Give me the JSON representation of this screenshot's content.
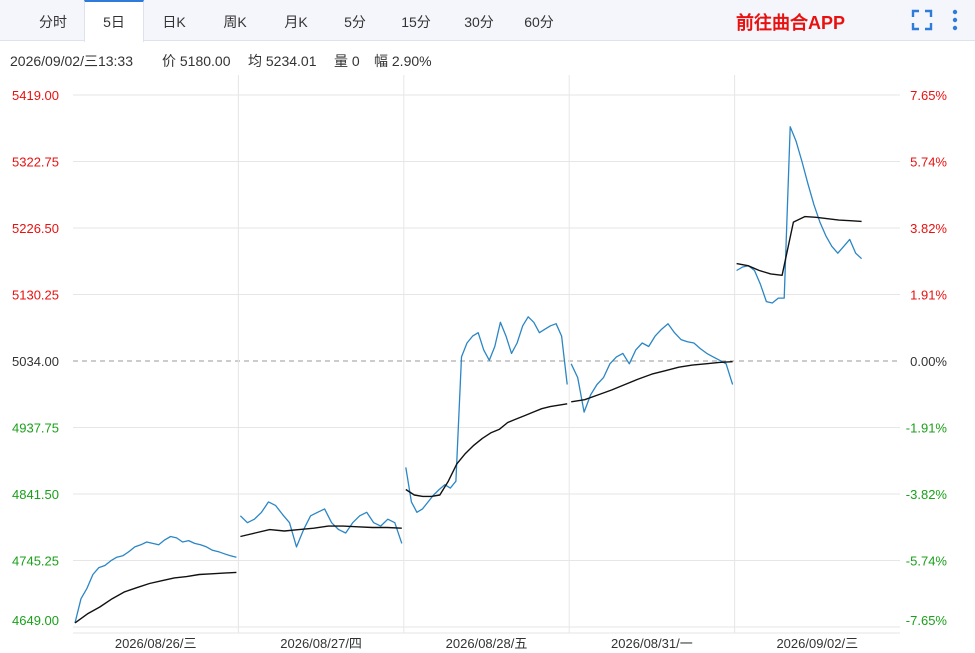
{
  "tabs": [
    {
      "label": "分时",
      "active": false
    },
    {
      "label": "5日",
      "active": true
    },
    {
      "label": "日K",
      "active": false
    },
    {
      "label": "周K",
      "active": false
    },
    {
      "label": "月K",
      "active": false
    },
    {
      "label": "5分",
      "active": false
    },
    {
      "label": "15分",
      "active": false
    },
    {
      "label": "30分",
      "active": false
    },
    {
      "label": "60分",
      "active": false
    }
  ],
  "app_link": "前往曲合APP",
  "icons": {
    "fullscreen": "fullscreen-icon",
    "more": "more-vertical-icon"
  },
  "info": {
    "datetime": "2026/09/02/三13:33",
    "price": "价 5180.00",
    "avg": "均 5234.01",
    "volume": "量 0",
    "amplitude": "幅 2.90%"
  },
  "colors": {
    "up": "#e8110f",
    "down": "#1aa01a",
    "neutral": "#333333",
    "price_line": "#2b86c6",
    "avg_line": "#111111",
    "grid": "#e6e6e6",
    "accent_tab": "#2f7bd9"
  },
  "chart_data": {
    "type": "line",
    "base": 5034.0,
    "ylim": [
      4649.0,
      5419.0
    ],
    "y_ticks": [
      "5419.00",
      "5322.75",
      "5226.50",
      "5130.25",
      "5034.00",
      "4937.75",
      "4841.50",
      "4745.25",
      "4649.00"
    ],
    "pct_ticks": [
      "7.65%",
      "5.74%",
      "3.82%",
      "1.91%",
      "0.00%",
      "-1.91%",
      "-3.82%",
      "-5.74%",
      "-7.65%"
    ],
    "days": [
      "2026/08/26/三",
      "2026/08/27/四",
      "2026/08/28/五",
      "2026/08/31/一",
      "2026/09/02/三"
    ],
    "grid": true,
    "series": [
      {
        "role": "price",
        "days": [
          [
            4655,
            4690,
            4705,
            4725,
            4735,
            4738,
            4745,
            4750,
            4752,
            4758,
            4765,
            4768,
            4772,
            4770,
            4768,
            4775,
            4780,
            4778,
            4772,
            4774,
            4770,
            4768,
            4765,
            4760,
            4758,
            4755,
            4752,
            4750
          ],
          [
            4810,
            4800,
            4805,
            4815,
            4830,
            4825,
            4812,
            4800,
            4765,
            4790,
            4810,
            4815,
            4820,
            4800,
            4790,
            4785,
            4800,
            4810,
            4815,
            4800,
            4795,
            4805,
            4800,
            4770
          ],
          [
            4880,
            4830,
            4815,
            4820,
            4830,
            4840,
            4848,
            4855,
            4850,
            4860,
            5040,
            5060,
            5070,
            5075,
            5050,
            5035,
            5055,
            5090,
            5070,
            5045,
            5060,
            5085,
            5098,
            5090,
            5075,
            5080,
            5085,
            5088,
            5070,
            5000
          ],
          [
            5030,
            5010,
            4960,
            4985,
            5000,
            5010,
            5030,
            5040,
            5045,
            5030,
            5050,
            5060,
            5055,
            5070,
            5080,
            5088,
            5075,
            5065,
            5062,
            5060,
            5052,
            5045,
            5040,
            5035,
            5030,
            5000
          ],
          [
            5165,
            5170,
            5172,
            5165,
            5145,
            5120,
            5118,
            5125,
            5125,
            5373,
            5352,
            5322,
            5290,
            5260,
            5235,
            5215,
            5200,
            5190,
            5200,
            5210,
            5190,
            5182
          ]
        ]
      },
      {
        "role": "avg",
        "days": [
          [
            4655,
            4668,
            4678,
            4690,
            4700,
            4706,
            4712,
            4716,
            4720,
            4722,
            4725,
            4726,
            4727,
            4728
          ],
          [
            4780,
            4785,
            4790,
            4788,
            4790,
            4792,
            4795,
            4795,
            4794,
            4793,
            4793,
            4792
          ],
          [
            4848,
            4840,
            4838,
            4838,
            4840,
            4860,
            4885,
            4900,
            4912,
            4922,
            4930,
            4935,
            4945,
            4950,
            4955,
            4960,
            4965,
            4968,
            4970,
            4972
          ],
          [
            4975,
            4978,
            4985,
            4992,
            5000,
            5008,
            5015,
            5020,
            5025,
            5028,
            5030,
            5032,
            5033
          ],
          [
            5175,
            5172,
            5165,
            5160,
            5158,
            5235,
            5243,
            5242,
            5240,
            5238,
            5237,
            5236
          ]
        ]
      }
    ]
  }
}
